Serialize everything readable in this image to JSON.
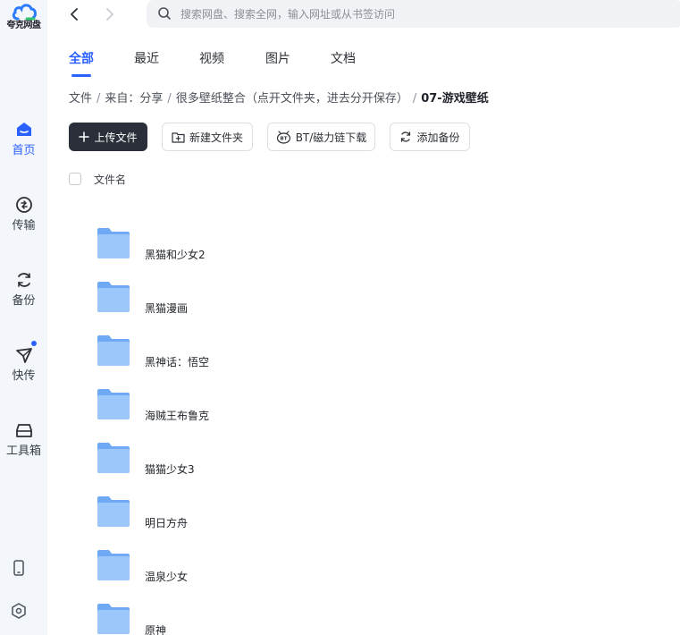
{
  "app": {
    "logo_text": "夸克网盘",
    "accent": "#2b61ff"
  },
  "sidebar": {
    "items": [
      {
        "label": "首页",
        "icon": "home-icon",
        "active": true
      },
      {
        "label": "传输",
        "icon": "transfer-icon",
        "active": false
      },
      {
        "label": "备份",
        "icon": "backup-icon",
        "active": false
      },
      {
        "label": "快传",
        "icon": "quick-send-icon",
        "active": false,
        "badge_dot": true
      },
      {
        "label": "工具箱",
        "icon": "toolbox-icon",
        "active": false
      }
    ],
    "bottom": [
      {
        "icon": "phone-icon"
      },
      {
        "icon": "settings-hex-icon"
      }
    ]
  },
  "topbar": {
    "search_placeholder": "搜索网盘、搜索全网，输入网址或从书签访问"
  },
  "tabs": [
    {
      "label": "全部",
      "active": true
    },
    {
      "label": "最近",
      "active": false
    },
    {
      "label": "视频",
      "active": false
    },
    {
      "label": "图片",
      "active": false
    },
    {
      "label": "文档",
      "active": false
    }
  ],
  "breadcrumb": {
    "items": [
      "文件",
      "来自：分享",
      "很多壁纸整合（点开文件夹，进去分开保存）"
    ],
    "current": "07-游戏壁纸"
  },
  "toolbar": {
    "upload": "上传文件",
    "new_folder": "新建文件夹",
    "bt": "BT/磁力链下载",
    "add_backup": "添加备份"
  },
  "list": {
    "column_name": "文件名",
    "files": [
      {
        "name": ""
      },
      {
        "name": "黑猫和少女2"
      },
      {
        "name": "黑猫漫画"
      },
      {
        "name": "黑神话：悟空"
      },
      {
        "name": "海贼王布鲁克"
      },
      {
        "name": "猫猫少女3"
      },
      {
        "name": "明日方舟"
      },
      {
        "name": "温泉少女"
      },
      {
        "name": "原神"
      }
    ]
  }
}
